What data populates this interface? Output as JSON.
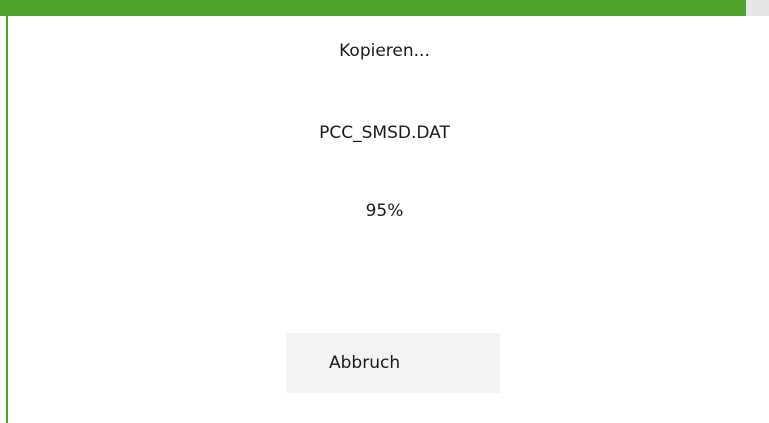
{
  "dialog": {
    "title": "Kopieren...",
    "filename": "PCC_SMSD.DAT",
    "percent_label": "95%",
    "progress": 0.97,
    "cancel_label": "Abbruch"
  },
  "colors": {
    "accent": "#4fa22d",
    "track": "#e6e6e6",
    "button_bg": "#f3f3f3",
    "text": "#1a1a1a"
  }
}
